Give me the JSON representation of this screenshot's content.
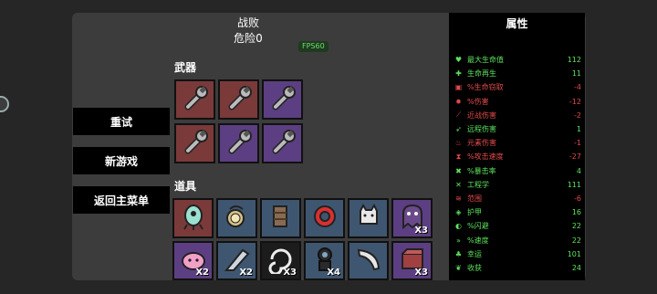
{
  "header": {
    "title": "战败",
    "danger": "危险0",
    "fps": "FPS60"
  },
  "sections": {
    "weapons": "武器",
    "items": "道具"
  },
  "menu": {
    "retry": "重试",
    "new_game": "新游戏",
    "main_menu": "返回主菜单"
  },
  "weapons": [
    {
      "icon": "wrench-icon",
      "tier": "red"
    },
    {
      "icon": "wrench-icon",
      "tier": "red"
    },
    {
      "icon": "wrench-icon",
      "tier": "purple"
    },
    {
      "icon": "wrench-icon",
      "tier": "red"
    },
    {
      "icon": "wrench-icon",
      "tier": "purple"
    },
    {
      "icon": "wrench-icon",
      "tier": "purple"
    }
  ],
  "items": [
    {
      "icon": "alien-pod-icon",
      "tier": "red",
      "count": ""
    },
    {
      "icon": "compass-icon",
      "tier": "blue",
      "count": ""
    },
    {
      "icon": "scarf-icon",
      "tier": "blue",
      "count": ""
    },
    {
      "icon": "ring-icon",
      "tier": "blue",
      "count": ""
    },
    {
      "icon": "cat-icon",
      "tier": "blue",
      "count": ""
    },
    {
      "icon": "ghost-icon",
      "tier": "purple",
      "count": "X3"
    },
    {
      "icon": "pink-blob-icon",
      "tier": "purple",
      "count": "X2"
    },
    {
      "icon": "blade-icon",
      "tier": "blue",
      "count": "X2"
    },
    {
      "icon": "swirl-icon",
      "tier": "black",
      "count": "X3"
    },
    {
      "icon": "diver-icon",
      "tier": "blue",
      "count": "X4"
    },
    {
      "icon": "horn-icon",
      "tier": "blue",
      "count": ""
    },
    {
      "icon": "box-icon",
      "tier": "purple",
      "count": "X3"
    }
  ],
  "stats": {
    "title": "属性",
    "rows": [
      {
        "icon": "heart-icon",
        "name": "最大生命值",
        "value": "112",
        "sign": "pos",
        "color": "#5de35d"
      },
      {
        "icon": "regen-icon",
        "name": "生命再生",
        "value": "11",
        "sign": "pos",
        "color": "#5de35d"
      },
      {
        "icon": "lifesteal-icon",
        "name": "%生命窃取",
        "value": "-4",
        "sign": "neg",
        "color": "#e34a4a"
      },
      {
        "icon": "damage-icon",
        "name": "%伤害",
        "value": "-12",
        "sign": "neg",
        "color": "#e34a4a"
      },
      {
        "icon": "sword-icon",
        "name": "近战伤害",
        "value": "-2",
        "sign": "neg",
        "color": "#e34a4a"
      },
      {
        "icon": "bow-icon",
        "name": "远程伤害",
        "value": "1",
        "sign": "pos",
        "color": "#5de35d"
      },
      {
        "icon": "flame-icon",
        "name": "元素伤害",
        "value": "-1",
        "sign": "neg",
        "color": "#e34a4a"
      },
      {
        "icon": "hourglass-icon",
        "name": "%攻击速度",
        "value": "-27",
        "sign": "neg",
        "color": "#e34a4a"
      },
      {
        "icon": "crit-icon",
        "name": "%暴击率",
        "value": "4",
        "sign": "pos",
        "color": "#5de35d"
      },
      {
        "icon": "engineering-icon",
        "name": "工程学",
        "value": "111",
        "sign": "pos",
        "color": "#5de35d"
      },
      {
        "icon": "range-icon",
        "name": "范围",
        "value": "-6",
        "sign": "neg",
        "color": "#e34a4a"
      },
      {
        "icon": "shield-icon",
        "name": "护甲",
        "value": "16",
        "sign": "pos",
        "color": "#5de35d"
      },
      {
        "icon": "dodge-icon",
        "name": "%闪避",
        "value": "22",
        "sign": "pos",
        "color": "#5de35d"
      },
      {
        "icon": "speed-icon",
        "name": "%速度",
        "value": "22",
        "sign": "pos",
        "color": "#5de35d"
      },
      {
        "icon": "luck-icon",
        "name": "幸运",
        "value": "101",
        "sign": "pos",
        "color": "#5de35d"
      },
      {
        "icon": "harvest-icon",
        "name": "收获",
        "value": "24",
        "sign": "pos",
        "color": "#5de35d"
      }
    ]
  }
}
